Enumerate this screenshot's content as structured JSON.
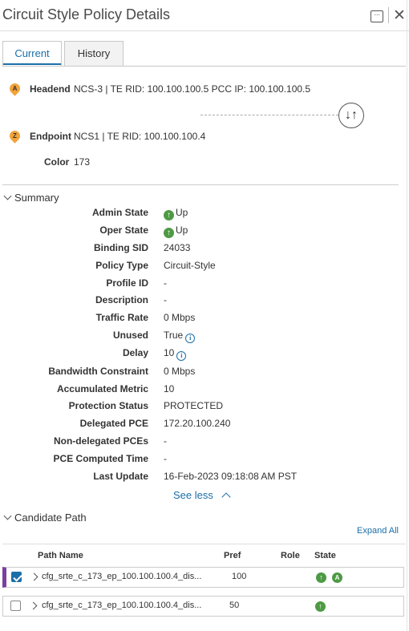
{
  "header": {
    "title": "Circuit Style Policy Details",
    "menu_glyph": "···",
    "close_glyph": "✕"
  },
  "tabs": [
    {
      "label": "Current",
      "active": true
    },
    {
      "label": "History",
      "active": false
    }
  ],
  "headend": {
    "pin_letter": "A",
    "label": "Headend",
    "value": "NCS-3 | TE RID: 100.100.100.5 PCC IP: 100.100.100.5"
  },
  "endpoint": {
    "pin_letter": "Z",
    "label": "Endpoint",
    "value": "NCS1 | TE RID: 100.100.100.4"
  },
  "color": {
    "label": "Color",
    "value": "173"
  },
  "swap_glyph": "↓↑",
  "summary": {
    "title": "Summary",
    "rows": [
      {
        "label": "Admin State",
        "value": "Up",
        "icon": "up-arrow-icon"
      },
      {
        "label": "Oper State",
        "value": "Up",
        "icon": "up-arrow-icon"
      },
      {
        "label": "Binding SID",
        "value": "24033"
      },
      {
        "label": "Policy Type",
        "value": "Circuit-Style"
      },
      {
        "label": "Profile ID",
        "value": "-"
      },
      {
        "label": "Description",
        "value": "-"
      },
      {
        "label": "Traffic Rate",
        "value": "0 Mbps"
      },
      {
        "label": "Unused",
        "value": "True",
        "info": true
      },
      {
        "label": "Delay",
        "value": "10",
        "info": true
      },
      {
        "label": "Bandwidth Constraint",
        "value": "0 Mbps"
      },
      {
        "label": "Accumulated Metric",
        "value": "10"
      },
      {
        "label": "Protection Status",
        "value": "PROTECTED"
      },
      {
        "label": "Delegated PCE",
        "value": "172.20.100.240"
      },
      {
        "label": "Non-delegated PCEs",
        "value": "-"
      },
      {
        "label": "PCE Computed Time",
        "value": "-"
      },
      {
        "label": "Last Update",
        "value": "16-Feb-2023 09:18:08 AM PST"
      }
    ],
    "see_less": "See less"
  },
  "candidate": {
    "title": "Candidate Path",
    "expand_all": "Expand All",
    "columns": {
      "path_name": "Path Name",
      "pref": "Pref",
      "role": "Role",
      "state": "State"
    },
    "rows": [
      {
        "path_name": "cfg_srte_c_173_ep_100.100.100.4_dis...",
        "pref": "100",
        "role": "",
        "checked": true,
        "states": [
          "up",
          "active"
        ]
      },
      {
        "path_name": "cfg_srte_c_173_ep_100.100.100.4_dis...",
        "pref": "50",
        "role": "",
        "checked": false,
        "states": [
          "up"
        ]
      }
    ]
  },
  "colors": {
    "accent": "#1b6fa8",
    "status_up": "#4e9a44",
    "pin": "#f2a33a",
    "selected_row": "#7b3fa0"
  }
}
